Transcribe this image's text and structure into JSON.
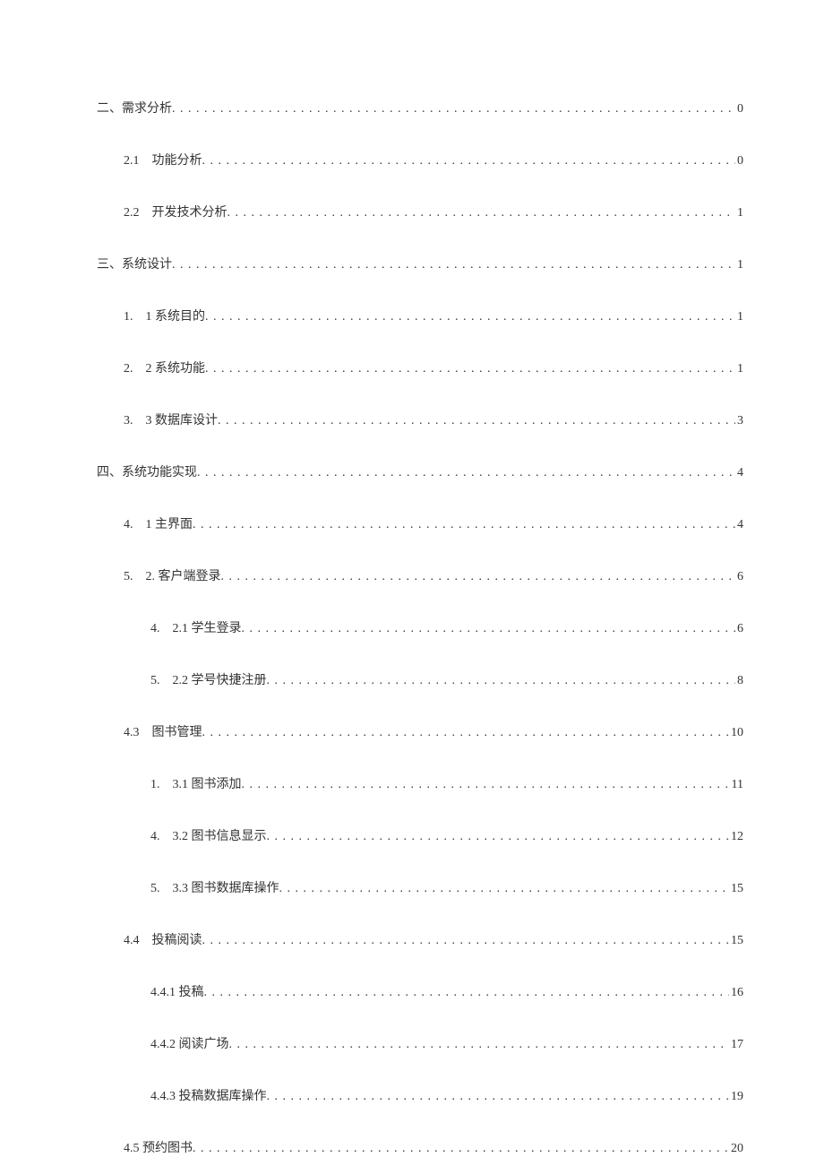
{
  "toc": [
    {
      "indent": 0,
      "prefix": "二、",
      "gap": "",
      "label": "需求分析",
      "afterGap": "",
      "page": "0"
    },
    {
      "indent": 1,
      "prefix": "2.1",
      "gap": "　",
      "label": "功能分析",
      "afterGap": "",
      "page": "0"
    },
    {
      "indent": 1,
      "prefix": "2.2",
      "gap": "　",
      "label": "开发技术分析",
      "afterGap": "",
      "page": "1"
    },
    {
      "indent": 0,
      "prefix": "三、",
      "gap": "",
      "label": "系统设计",
      "afterGap": "",
      "page": "1"
    },
    {
      "indent": 1,
      "prefix": "1.",
      "gap": "　",
      "label": "1 系统目的",
      "afterGap": " ",
      "page": "1"
    },
    {
      "indent": 1,
      "prefix": "2.",
      "gap": "　",
      "label": "2 系统功能",
      "afterGap": " ",
      "page": "1"
    },
    {
      "indent": 1,
      "prefix": "3.",
      "gap": "　",
      "label": "3 数据库设计",
      "afterGap": " ",
      "page": "3"
    },
    {
      "indent": 0,
      "prefix": "四、",
      "gap": "",
      "label": "系统功能实现",
      "afterGap": "",
      "page": "4"
    },
    {
      "indent": 1,
      "prefix": "4.",
      "gap": "　",
      "label": "1 主界面",
      "afterGap": " ",
      "page": "4"
    },
    {
      "indent": 1,
      "prefix": "5.",
      "gap": "　",
      "label": "2. 客户端登录",
      "afterGap": "",
      "page": "6"
    },
    {
      "indent": 2,
      "prefix": "4.",
      "gap": "　",
      "label": "2.1 学生登录",
      "afterGap": " ",
      "page": "6"
    },
    {
      "indent": 2,
      "prefix": "5.",
      "gap": "　",
      "label": "2.2 学号快捷注册",
      "afterGap": " ",
      "page": "8"
    },
    {
      "indent": 1,
      "prefix": "4.3",
      "gap": "　",
      "label": "图书管理",
      "afterGap": " ",
      "page": "10"
    },
    {
      "indent": 2,
      "prefix": "1.",
      "gap": "　",
      "label": "3.1 图书添加",
      "afterGap": " ",
      "page": "11"
    },
    {
      "indent": 2,
      "prefix": "4.",
      "gap": "　",
      "label": "3.2 图书信息显示",
      "afterGap": " ",
      "page": "12"
    },
    {
      "indent": 2,
      "prefix": "5.",
      "gap": "　",
      "label": "3.3 图书数据库操作",
      "afterGap": " ",
      "page": "15"
    },
    {
      "indent": 1,
      "prefix": "4.4",
      "gap": "　",
      "label": "投稿阅读",
      "afterGap": " ",
      "page": "15"
    },
    {
      "indent": 2,
      "prefix": "",
      "gap": "",
      "label": "4.4.1 投稿",
      "afterGap": "",
      "page": "16"
    },
    {
      "indent": 2,
      "prefix": "",
      "gap": "",
      "label": "4.4.2 阅读广场",
      "afterGap": "",
      "page": "17"
    },
    {
      "indent": 2,
      "prefix": "",
      "gap": "",
      "label": "4.4.3 投稿数据库操作",
      "afterGap": " ",
      "page": "19"
    },
    {
      "indent": 1,
      "prefix": "",
      "gap": "",
      "label": "4.5 预约图书",
      "afterGap": "",
      "page": "20"
    }
  ]
}
